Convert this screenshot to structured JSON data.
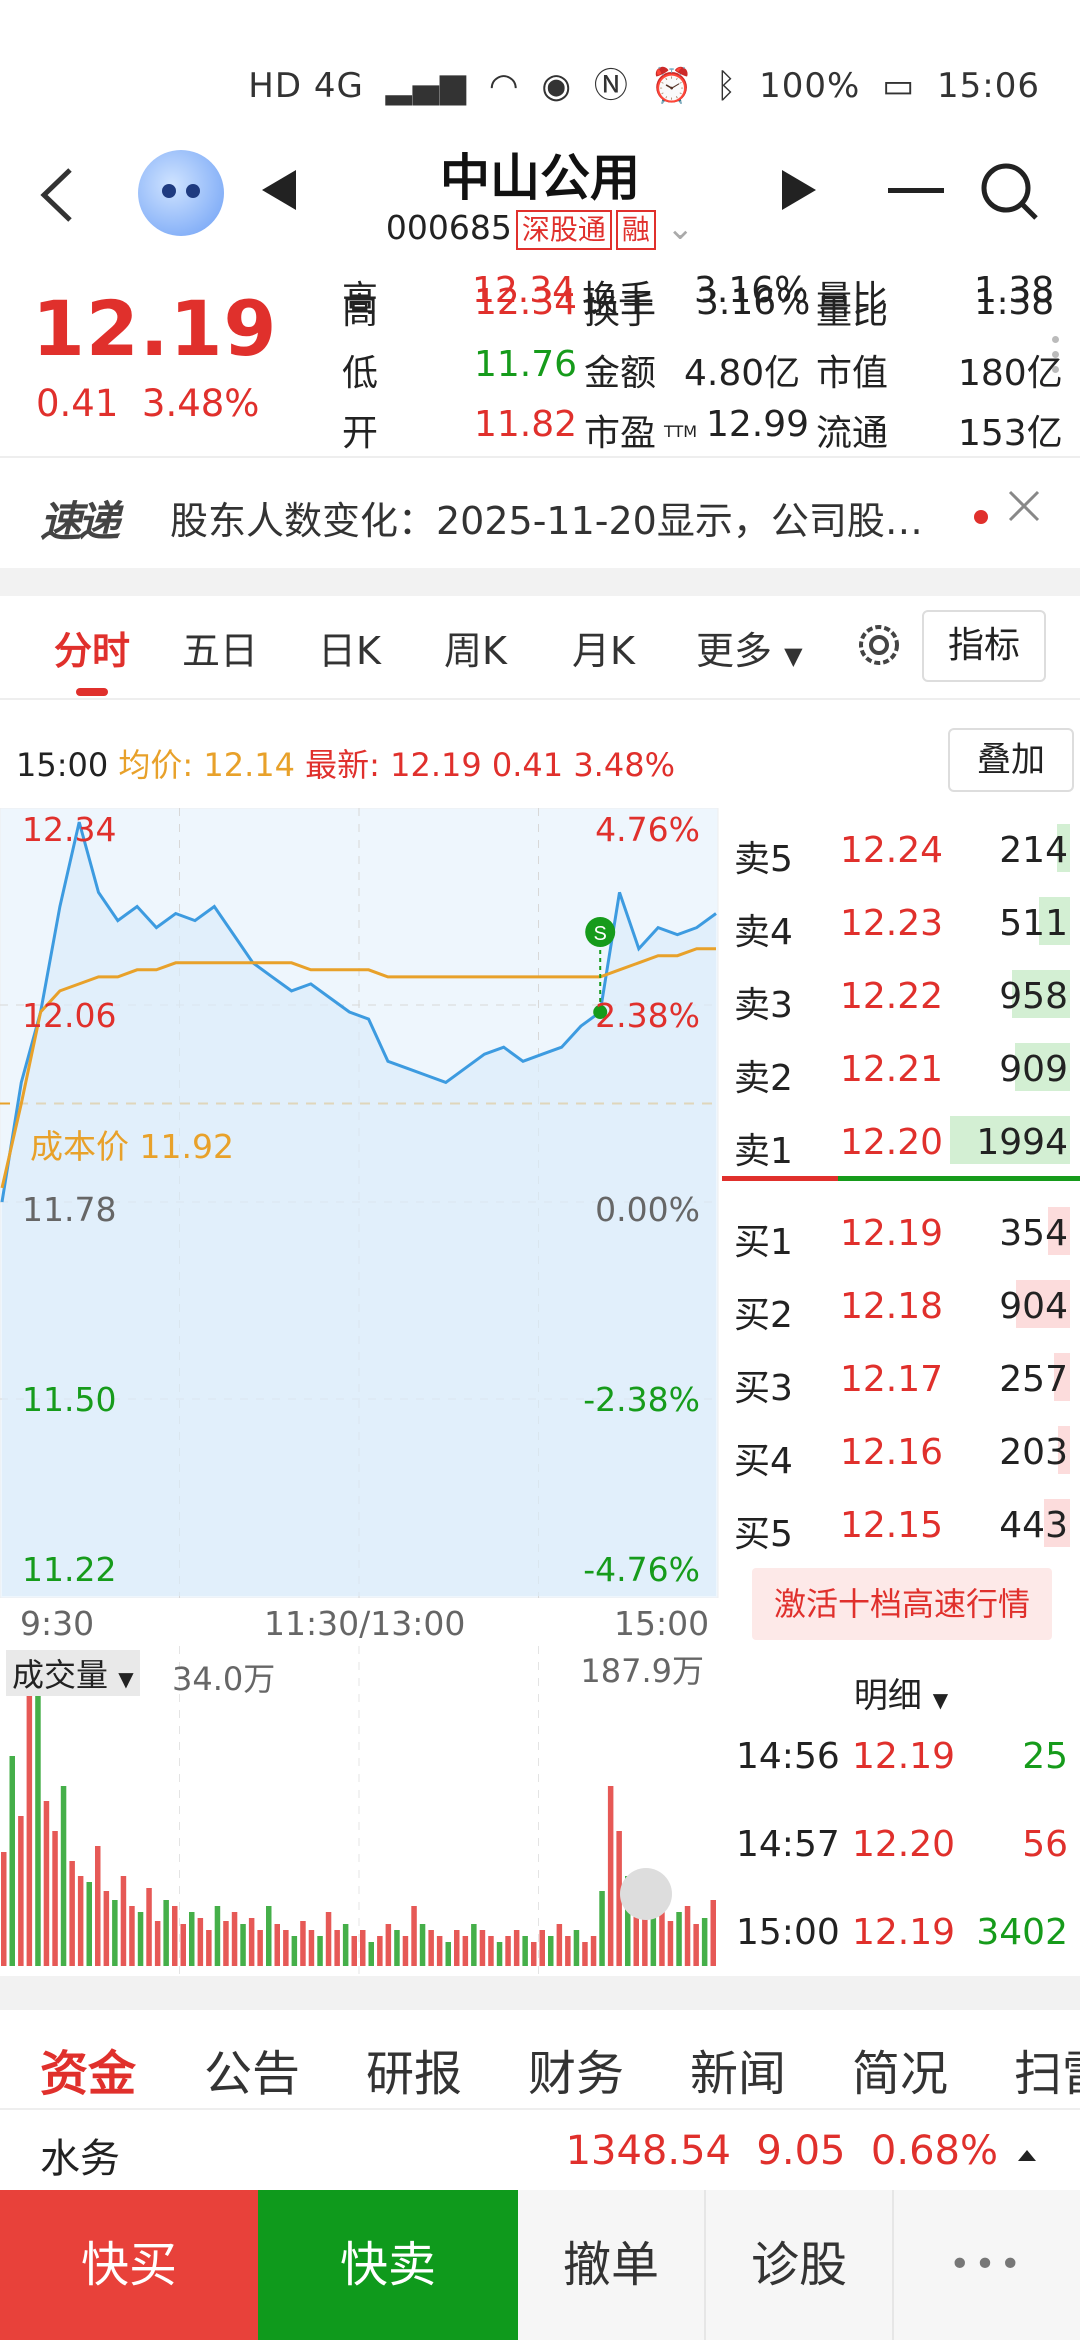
{
  "status_bar": {
    "network": "HD 4G",
    "battery": "100%",
    "time": "15:06"
  },
  "header": {
    "stock_name": "中山公用",
    "stock_code": "000685",
    "tag_connect": "深股通",
    "tag_margin": "融"
  },
  "quote": {
    "price": "12.19",
    "change": "0.41",
    "change_pct": "3.48%",
    "rows": [
      {
        "l1": "高",
        "v1": "12.34",
        "l2": "换手",
        "v2": "3.16%",
        "l3": "量比",
        "v3": "1.38"
      },
      {
        "l1": "低",
        "v1": "11.76",
        "l2": "金额",
        "v2": "4.80亿",
        "l3": "市值",
        "v3": "180亿"
      },
      {
        "l1": "开",
        "v1": "11.82",
        "l2": "市盈",
        "l2_sub": "TTM",
        "v2": "12.99",
        "l3": "流通",
        "v3": "153亿"
      }
    ]
  },
  "news": {
    "logo": "速递",
    "text": "股东人数变化：2025-11-20显示，公司股…"
  },
  "period_tabs": [
    "分时",
    "五日",
    "日K",
    "周K",
    "月K",
    "更多"
  ],
  "indicator_button": "指标",
  "info_row": {
    "time": "15:00",
    "avg_label": "均价:",
    "avg_value": "12.14",
    "latest_label": "最新:",
    "latest_value": "12.19 0.41 3.48%",
    "overlay_button": "叠加"
  },
  "chart_data": {
    "type": "line",
    "title": "",
    "x_labels": [
      "9:30",
      "11:30/13:00",
      "15:00"
    ],
    "y_left_ticks": [
      "12.34",
      "12.06",
      "11.78",
      "11.50",
      "11.22"
    ],
    "y_right_ticks": [
      "4.76%",
      "2.38%",
      "0.00%",
      "-2.38%",
      "-4.76%"
    ],
    "ylim": [
      11.22,
      12.34
    ],
    "prev_close": 11.78,
    "cost_label": "成本价 11.92",
    "cost_value": 11.92,
    "signal_marker": "S",
    "series": [
      {
        "name": "价格",
        "color": "#3d9be0",
        "values": [
          11.78,
          11.95,
          12.05,
          12.2,
          12.32,
          12.22,
          12.18,
          12.2,
          12.17,
          12.19,
          12.18,
          12.2,
          12.16,
          12.12,
          12.1,
          12.08,
          12.09,
          12.07,
          12.05,
          12.04,
          11.98,
          11.97,
          11.96,
          11.95,
          11.97,
          11.99,
          12.0,
          11.98,
          11.99,
          12.0,
          12.03,
          12.05,
          12.22,
          12.14,
          12.17,
          12.16,
          12.17,
          12.19
        ]
      },
      {
        "name": "均价",
        "color": "#e8a12a",
        "values": [
          11.8,
          11.92,
          12.05,
          12.08,
          12.09,
          12.1,
          12.1,
          12.11,
          12.11,
          12.12,
          12.12,
          12.12,
          12.12,
          12.12,
          12.12,
          12.12,
          12.11,
          12.11,
          12.11,
          12.11,
          12.1,
          12.1,
          12.1,
          12.1,
          12.1,
          12.1,
          12.1,
          12.1,
          12.1,
          12.1,
          12.1,
          12.1,
          12.11,
          12.12,
          12.13,
          12.13,
          12.14,
          12.14
        ]
      }
    ]
  },
  "volume": {
    "label": "成交量",
    "value_left": "34.0万",
    "value_right": "187.9万",
    "bars": [
      38,
      70,
      50,
      90,
      100,
      55,
      45,
      60,
      35,
      30,
      28,
      40,
      25,
      22,
      30,
      20,
      18,
      26,
      15,
      22,
      20,
      14,
      18,
      16,
      12,
      20,
      15,
      18,
      14,
      16,
      12,
      20,
      14,
      12,
      10,
      15,
      12,
      10,
      18,
      12,
      14,
      10,
      12,
      8,
      10,
      14,
      12,
      10,
      20,
      14,
      12,
      10,
      8,
      12,
      10,
      14,
      12,
      10,
      8,
      10,
      12,
      10,
      8,
      12,
      10,
      14,
      10,
      12,
      8,
      10,
      25,
      60,
      45,
      30,
      25,
      20,
      18,
      22,
      15,
      18,
      20,
      14,
      16,
      22
    ]
  },
  "order_book": {
    "asks": [
      {
        "label": "卖5",
        "price": "12.24",
        "vol": "214",
        "bar": 0.11
      },
      {
        "label": "卖4",
        "price": "12.23",
        "vol": "511",
        "bar": 0.26
      },
      {
        "label": "卖3",
        "price": "12.22",
        "vol": "958",
        "bar": 0.48
      },
      {
        "label": "卖2",
        "price": "12.21",
        "vol": "909",
        "bar": 0.46
      },
      {
        "label": "卖1",
        "price": "12.20",
        "vol": "1994",
        "bar": 1.0
      }
    ],
    "bids": [
      {
        "label": "买1",
        "price": "12.19",
        "vol": "354",
        "bar": 0.18
      },
      {
        "label": "买2",
        "price": "12.18",
        "vol": "904",
        "bar": 0.45
      },
      {
        "label": "买3",
        "price": "12.17",
        "vol": "257",
        "bar": 0.13
      },
      {
        "label": "买4",
        "price": "12.16",
        "vol": "203",
        "bar": 0.1
      },
      {
        "label": "买5",
        "price": "12.15",
        "vol": "443",
        "bar": 0.22
      }
    ],
    "activate_button": "激活十档高速行情"
  },
  "detail": {
    "header": "明细",
    "rows": [
      {
        "time": "14:56",
        "price": "12.19",
        "vol": "25",
        "vol_color": "green"
      },
      {
        "time": "14:57",
        "price": "12.20",
        "vol": "56",
        "vol_color": "red"
      },
      {
        "time": "15:00",
        "price": "12.19",
        "vol": "3402",
        "vol_color": "green"
      }
    ]
  },
  "bottom_tabs": [
    "资金",
    "公告",
    "研报",
    "财务",
    "新闻",
    "简况",
    "扫雷"
  ],
  "sector": {
    "name": "水务",
    "value": "1348.54",
    "change": "9.05",
    "pct": "0.68%"
  },
  "actions": {
    "buy": "快买",
    "sell": "快卖",
    "cancel": "撤单",
    "diagnose": "诊股",
    "more": "•••"
  },
  "colors": {
    "up": "#e0302c",
    "down": "#169b1b",
    "price_line": "#3d9be0",
    "avg_line": "#e8a12a"
  }
}
